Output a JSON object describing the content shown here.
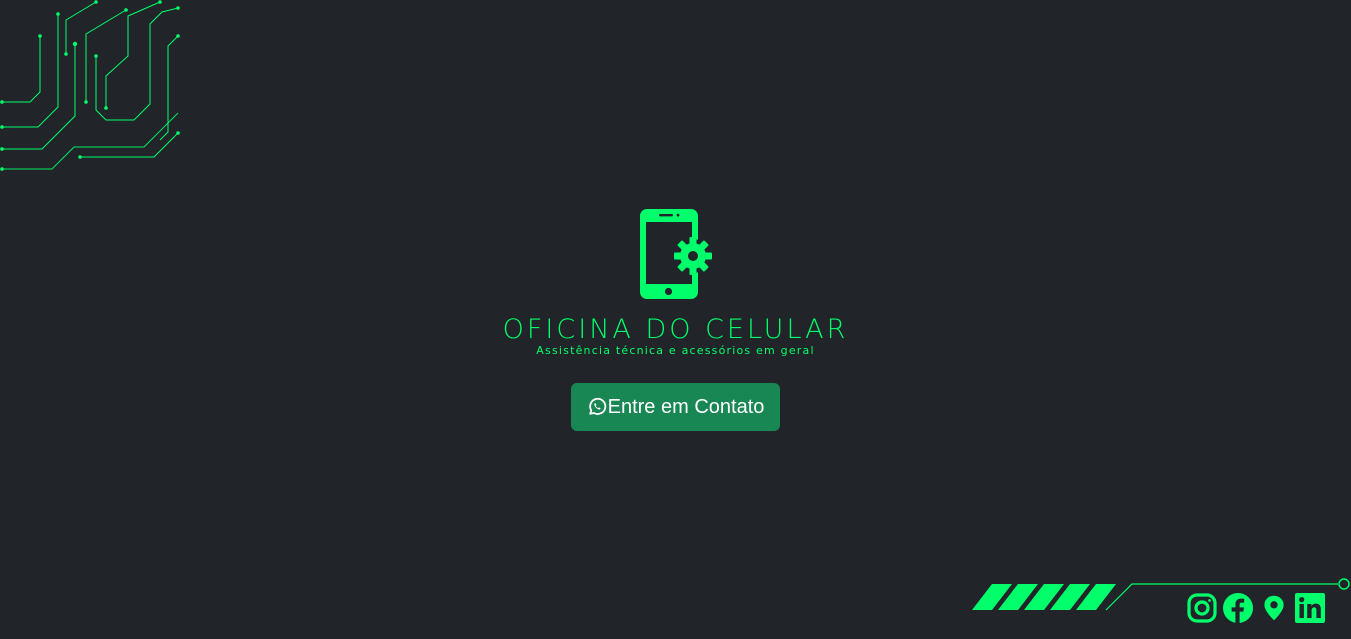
{
  "brand": {
    "title": "Oficina do Celular",
    "subtitle": "Assistência técnica e acessórios em geral",
    "logo_icon": "phone-gear-icon"
  },
  "cta": {
    "label": "Entre em Contato",
    "icon": "whatsapp-icon"
  },
  "social": {
    "items": [
      {
        "icon": "instagram-icon"
      },
      {
        "icon": "facebook-icon"
      },
      {
        "icon": "map-pin-icon"
      },
      {
        "icon": "linkedin-icon"
      }
    ]
  },
  "colors": {
    "background": "#212529",
    "accent": "#00ff6a",
    "button": "#198754",
    "button_text": "#ffffff"
  }
}
